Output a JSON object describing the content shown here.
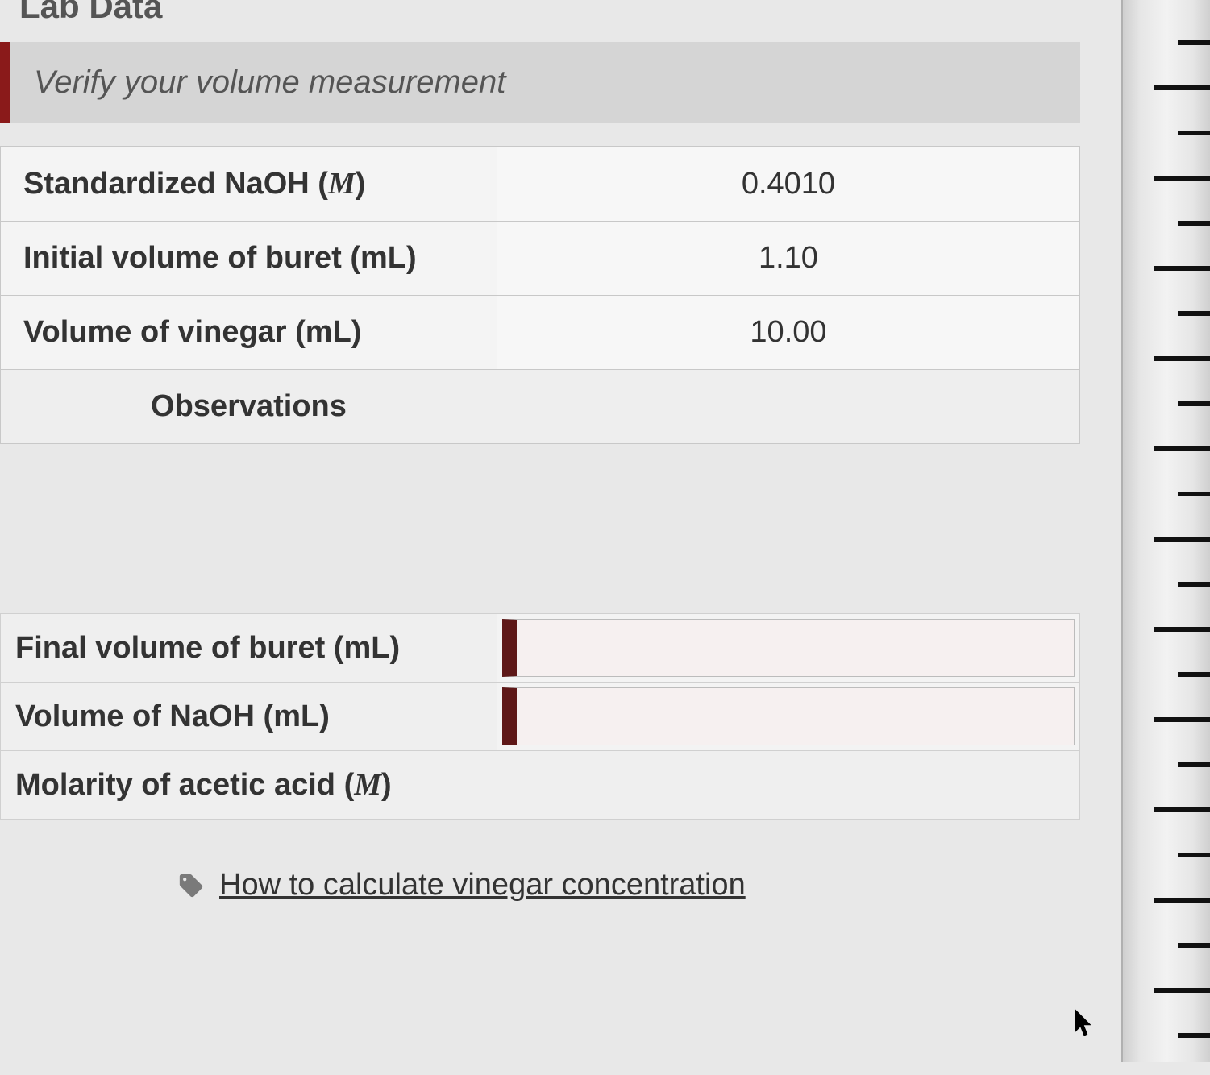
{
  "title": "Lab Data",
  "banner": {
    "message": "Verify your volume measurement"
  },
  "table1": {
    "rows": [
      {
        "label_pre": "Standardized NaOH (",
        "label_var": "M",
        "label_post": ")",
        "value": "0.4010"
      },
      {
        "label": "Initial volume of buret (mL)",
        "value": "1.10"
      },
      {
        "label": "Volume of vinegar (mL)",
        "value": "10.00"
      }
    ],
    "observations_header": "Observations"
  },
  "table2": {
    "rows": [
      {
        "label": "Final volume of buret (mL)",
        "input_value": ""
      },
      {
        "label": "Volume of NaOH (mL)",
        "input_value": ""
      }
    ],
    "acetic": {
      "label_pre": "Molarity of acetic acid (",
      "label_var": "M",
      "label_post": ")"
    }
  },
  "help": {
    "link_text": "How to calculate vinegar concentration"
  },
  "colors": {
    "accent": "#8a1a1a",
    "input_edge": "#5e1818"
  }
}
